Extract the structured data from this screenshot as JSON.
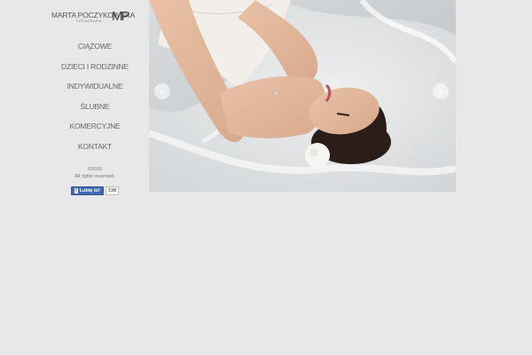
{
  "logo": {
    "name": "MARTA POCZYKOWSKA",
    "sub": "FOTOGRAFIA",
    "mark": "MP"
  },
  "menu": [
    {
      "label": "CIĄŻOWE"
    },
    {
      "label": "DZIECI I RODZINNE"
    },
    {
      "label": "INDYWIDUALNE"
    },
    {
      "label": "ŚLUBNE"
    },
    {
      "label": "KOMERCYJNE"
    },
    {
      "label": "KONTAKT"
    }
  ],
  "footer": {
    "copyright": "©2016",
    "rights": "All rights reserved."
  },
  "facebook": {
    "like_label": "Lubię to!",
    "count": "138"
  },
  "slider": {
    "prev_icon": "chevron-left-icon",
    "next_icon": "chevron-right-icon"
  }
}
